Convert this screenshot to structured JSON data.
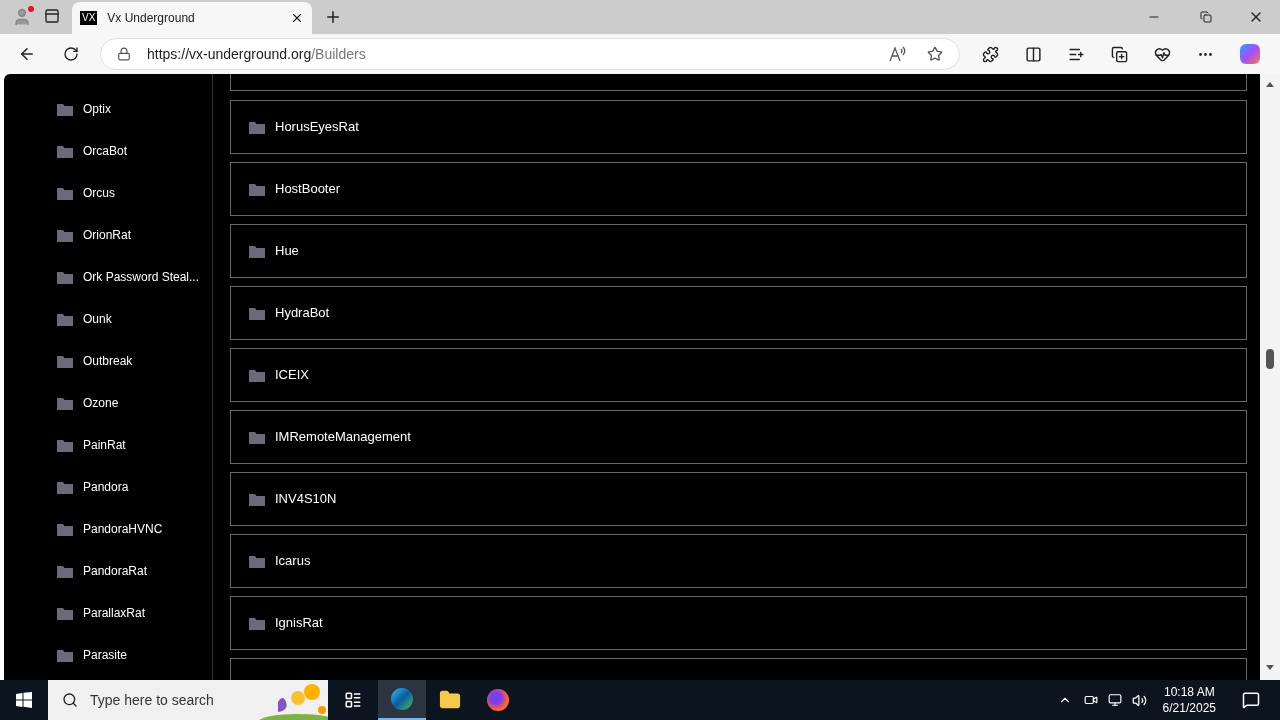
{
  "browser": {
    "tab": {
      "favicon": "VX",
      "title": "Vx Underground"
    },
    "url": {
      "origin": "https://vx-underground.org",
      "path": "/Builders"
    }
  },
  "sidebar": {
    "items": [
      {
        "label": "Optix"
      },
      {
        "label": "OrcaBot"
      },
      {
        "label": "Orcus"
      },
      {
        "label": "OrionRat"
      },
      {
        "label": "Ork Password Steal..."
      },
      {
        "label": "Ounk"
      },
      {
        "label": "Outbreak"
      },
      {
        "label": "Ozone"
      },
      {
        "label": "PainRat"
      },
      {
        "label": "Pandora"
      },
      {
        "label": "PandoraHVNC"
      },
      {
        "label": "PandoraRat"
      },
      {
        "label": "ParallaxRat"
      },
      {
        "label": "Parasite"
      }
    ]
  },
  "folders": [
    {
      "label": "HorusEyesRat"
    },
    {
      "label": "HostBooter"
    },
    {
      "label": "Hue"
    },
    {
      "label": "HydraBot"
    },
    {
      "label": "ICEIX"
    },
    {
      "label": "IMRemoteManagement"
    },
    {
      "label": "INV4S10N"
    },
    {
      "label": "Icarus"
    },
    {
      "label": "IgnisRat"
    }
  ],
  "taskbar": {
    "search_placeholder": "Type here to search",
    "time": "10:18 AM",
    "date": "6/21/2025"
  }
}
